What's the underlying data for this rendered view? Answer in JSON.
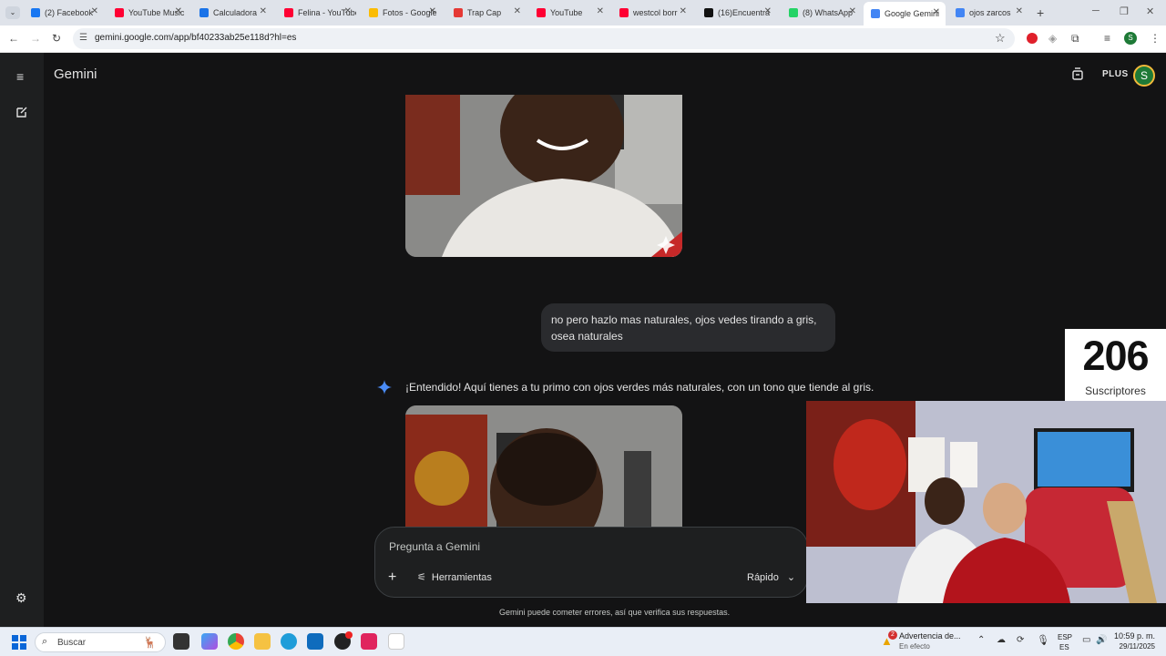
{
  "browser": {
    "tabs": [
      {
        "label": "(2) Facebook",
        "icon": "facebook-icon",
        "color": "#1877f2"
      },
      {
        "label": "YouTube Music",
        "icon": "youtube-music-icon",
        "color": "#ff0033"
      },
      {
        "label": "Calculadora",
        "icon": "calculator-icon",
        "color": "#1a73e8"
      },
      {
        "label": "Felina - YouTube",
        "icon": "youtube-icon",
        "color": "#ff0033"
      },
      {
        "label": "Fotos - Google",
        "icon": "google-photos-icon",
        "color": "#fbbc04"
      },
      {
        "label": "Trap Cap",
        "icon": "trap-icon",
        "color": "#e53935"
      },
      {
        "label": "YouTube",
        "icon": "youtube-icon",
        "color": "#ff0033"
      },
      {
        "label": "westcol borr",
        "icon": "youtube-icon",
        "color": "#ff0033"
      },
      {
        "label": "(16)Encuentra",
        "icon": "tiktok-icon",
        "color": "#111111"
      },
      {
        "label": "(8) WhatsApp",
        "icon": "whatsapp-icon",
        "color": "#25d366"
      },
      {
        "label": "Google Gemini",
        "icon": "gemini-icon",
        "color": "#4285f4",
        "active": true
      },
      {
        "label": "ojos zarcos",
        "icon": "google-icon",
        "color": "#4285f4"
      }
    ],
    "url": "gemini.google.com/app/bf40233ab25e118d?hl=es"
  },
  "gemini": {
    "title": "Gemini",
    "plan": "PLUS",
    "avatar_letter": "S",
    "user_message": "no pero hazlo mas naturales, ojos vedes tirando a gris, osea naturales",
    "response": "¡Entendido! Aquí tienes a tu primo con ojos verdes más naturales, con un tono que tiende al gris.",
    "input_placeholder": "Pregunta a Gemini",
    "tools_label": "Herramientas",
    "mode_label": "Rápido",
    "disclaimer": "Gemini puede cometer errores, así que verifica sus respuestas."
  },
  "overlay": {
    "subscriber_count": "206",
    "subscriber_label": "Suscriptores"
  },
  "taskbar": {
    "search_placeholder": "Buscar",
    "notification_badge": "2",
    "notification_title": "Advertencia de...",
    "notification_sub": "En efecto",
    "lang_top": "ESP",
    "lang_bottom": "ES",
    "time": "10:59 p. m.",
    "date": "29/11/2025"
  },
  "colors": {
    "background": "#131314",
    "sidebar": "#1e1f20",
    "accent": "#4285f4",
    "avatar_bg": "#1e7a37"
  }
}
